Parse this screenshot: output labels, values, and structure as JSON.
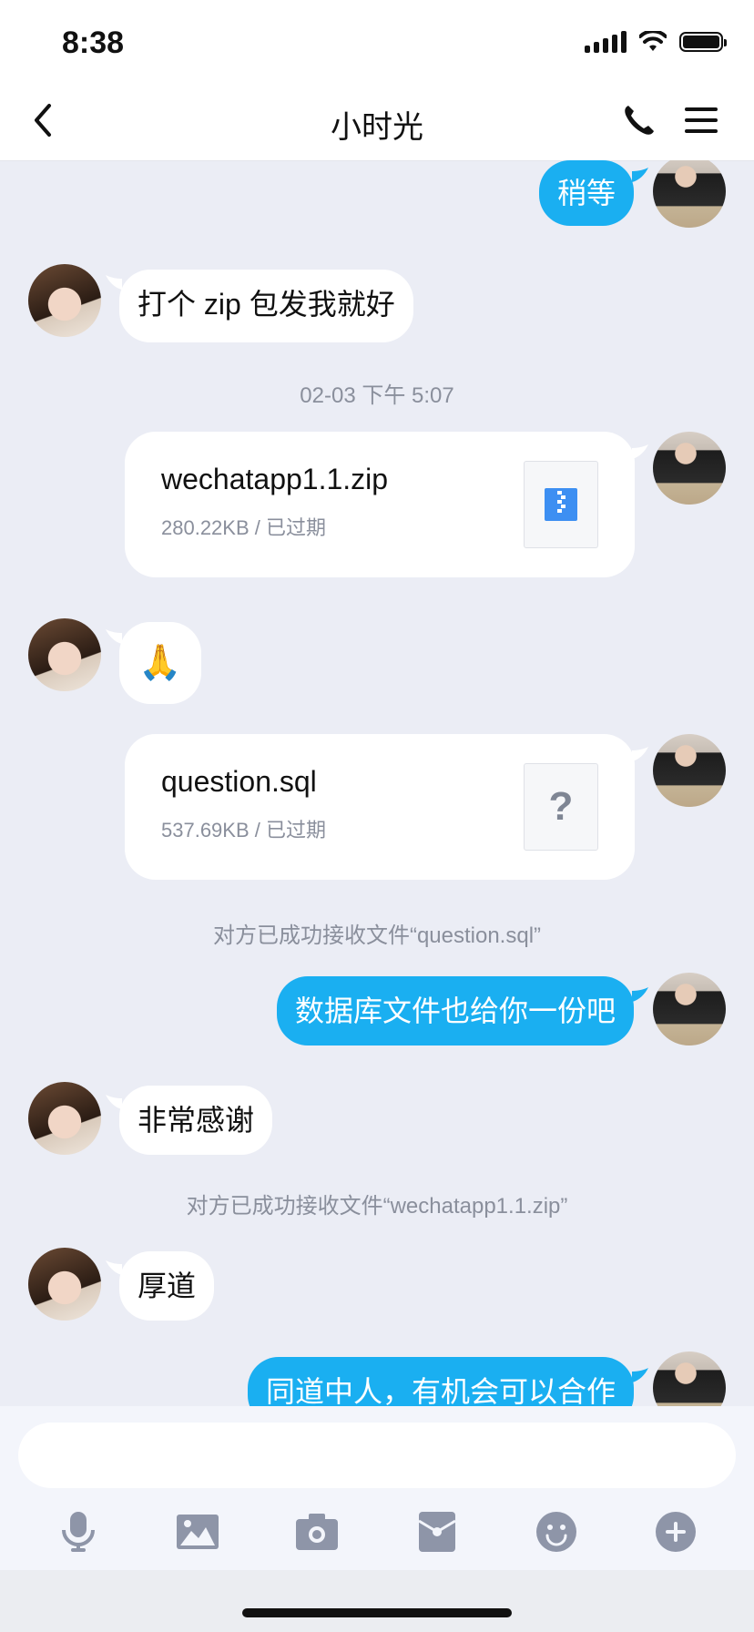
{
  "status_bar": {
    "time": "8:38"
  },
  "header": {
    "title": "小时光"
  },
  "messages": {
    "m1": "稍等",
    "m2": "打个 zip 包发我就好",
    "time1": "02-03 下午 5:07",
    "file1": {
      "name": "wechatapp1.1.zip",
      "meta": "280.22KB / 已过期",
      "icon": "zip-file-icon"
    },
    "m3": "🙏",
    "file2": {
      "name": "question.sql",
      "meta": "537.69KB / 已过期",
      "icon": "unknown-file-icon",
      "glyph": "?"
    },
    "notice1": "对方已成功接收文件“question.sql”",
    "m4": "数据库文件也给你一份吧",
    "m5": "非常感谢",
    "notice2": "对方已成功接收文件“wechatapp1.1.zip”",
    "m6": "厚道",
    "m7": "同道中人，有机会可以合作"
  },
  "input": {
    "value": "",
    "placeholder": ""
  },
  "toolbar": [
    "microphone-icon",
    "image-icon",
    "camera-icon",
    "red-packet-icon",
    "emoji-icon",
    "plus-icon"
  ],
  "colors": {
    "accent": "#1aaff1",
    "background": "#ebedf5",
    "icon": "#8e95a8"
  }
}
